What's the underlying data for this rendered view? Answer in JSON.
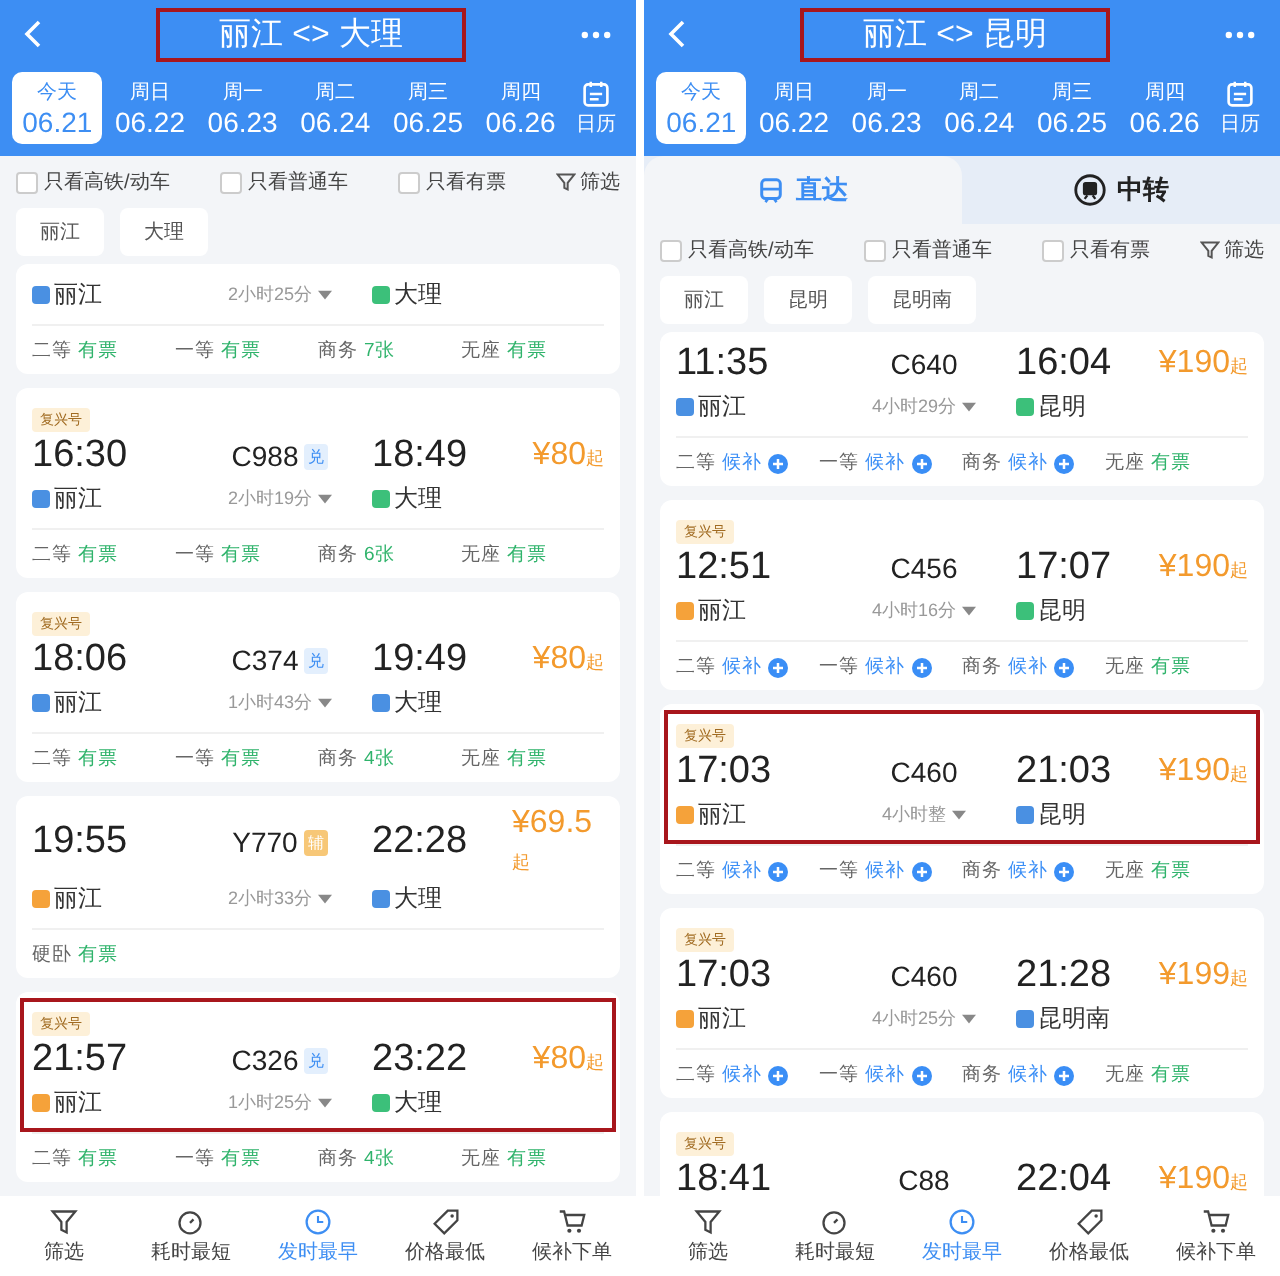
{
  "panels": [
    {
      "title": "丽江 <> 大理",
      "title_highlighted": true,
      "dates": [
        {
          "weekday": "今天",
          "date": "06.21",
          "selected": true
        },
        {
          "weekday": "周日",
          "date": "06.22",
          "selected": false
        },
        {
          "weekday": "周一",
          "date": "06.23",
          "selected": false
        },
        {
          "weekday": "周二",
          "date": "06.24",
          "selected": false
        },
        {
          "weekday": "周三",
          "date": "06.25",
          "selected": false
        },
        {
          "weekday": "周四",
          "date": "06.26",
          "selected": false
        }
      ],
      "calendar": "日历",
      "filters": [
        {
          "label": "只看高铁/动车",
          "checked": false
        },
        {
          "label": "只看普通车",
          "checked": false
        },
        {
          "label": "只看有票",
          "checked": false
        }
      ],
      "filter_button": "筛选",
      "stations": [
        "丽江",
        "大理"
      ],
      "trains": [
        {
          "from": {
            "name": "丽江",
            "color": "#4a90e2"
          },
          "duration": "2小时25分",
          "to": {
            "name": "大理",
            "color": "#3cc07a"
          },
          "highlighted": false,
          "seats": [
            {
              "label": "二等",
              "status": "有票",
              "waitlist": false
            },
            {
              "label": "一等",
              "status": "有票",
              "waitlist": false
            },
            {
              "label": "商务",
              "status": "7张",
              "waitlist": false
            },
            {
              "label": "无座",
              "status": "有票",
              "waitlist": false
            }
          ]
        },
        {
          "tag": "复兴号",
          "dep": "16:30",
          "train_no": "C988",
          "badge": {
            "text": "兑",
            "kind": "blue"
          },
          "arr": "18:49",
          "price": "¥80",
          "price_suffix": "起",
          "from": {
            "name": "丽江",
            "color": "#4a90e2"
          },
          "duration": "2小时19分",
          "to": {
            "name": "大理",
            "color": "#3cc07a"
          },
          "highlighted": false,
          "seats": [
            {
              "label": "二等",
              "status": "有票",
              "waitlist": false
            },
            {
              "label": "一等",
              "status": "有票",
              "waitlist": false
            },
            {
              "label": "商务",
              "status": "6张",
              "waitlist": false
            },
            {
              "label": "无座",
              "status": "有票",
              "waitlist": false
            }
          ]
        },
        {
          "tag": "复兴号",
          "dep": "18:06",
          "train_no": "C374",
          "badge": {
            "text": "兑",
            "kind": "blue"
          },
          "arr": "19:49",
          "price": "¥80",
          "price_suffix": "起",
          "from": {
            "name": "丽江",
            "color": "#4a90e2"
          },
          "duration": "1小时43分",
          "to": {
            "name": "大理",
            "color": "#4a90e2"
          },
          "highlighted": false,
          "seats": [
            {
              "label": "二等",
              "status": "有票",
              "waitlist": false
            },
            {
              "label": "一等",
              "status": "有票",
              "waitlist": false
            },
            {
              "label": "商务",
              "status": "4张",
              "waitlist": false
            },
            {
              "label": "无座",
              "status": "有票",
              "waitlist": false
            }
          ]
        },
        {
          "dep": "19:55",
          "train_no": "Y770",
          "badge": {
            "text": "辅",
            "kind": "orange"
          },
          "arr": "22:28",
          "price": "¥69.5",
          "price_suffix": "起",
          "from": {
            "name": "丽江",
            "color": "#f5a23a"
          },
          "duration": "2小时33分",
          "to": {
            "name": "大理",
            "color": "#4a90e2"
          },
          "highlighted": false,
          "seats": [
            {
              "label": "硬卧",
              "status": "有票",
              "waitlist": false
            }
          ]
        },
        {
          "tag": "复兴号",
          "dep": "21:57",
          "train_no": "C326",
          "badge": {
            "text": "兑",
            "kind": "blue"
          },
          "arr": "23:22",
          "price": "¥80",
          "price_suffix": "起",
          "from": {
            "name": "丽江",
            "color": "#f5a23a"
          },
          "duration": "1小时25分",
          "to": {
            "name": "大理",
            "color": "#3cc07a"
          },
          "highlighted": true,
          "seats": [
            {
              "label": "二等",
              "status": "有票",
              "waitlist": false
            },
            {
              "label": "一等",
              "status": "有票",
              "waitlist": false
            },
            {
              "label": "商务",
              "status": "4张",
              "waitlist": false
            },
            {
              "label": "无座",
              "status": "有票",
              "waitlist": false
            }
          ]
        }
      ],
      "bottom_nav": [
        {
          "kind": "filter",
          "label": "筛选",
          "selected": false
        },
        {
          "kind": "timer",
          "label": "耗时最短",
          "selected": false
        },
        {
          "kind": "early",
          "label": "发时最早",
          "selected": true
        },
        {
          "kind": "price",
          "label": "价格最低",
          "selected": false
        },
        {
          "kind": "cart",
          "label": "候补下单",
          "selected": false
        }
      ]
    },
    {
      "title": "丽江 <> 昆明",
      "title_highlighted": true,
      "dates": [
        {
          "weekday": "今天",
          "date": "06.21",
          "selected": true
        },
        {
          "weekday": "周日",
          "date": "06.22",
          "selected": false
        },
        {
          "weekday": "周一",
          "date": "06.23",
          "selected": false
        },
        {
          "weekday": "周二",
          "date": "06.24",
          "selected": false
        },
        {
          "weekday": "周三",
          "date": "06.25",
          "selected": false
        },
        {
          "weekday": "周四",
          "date": "06.26",
          "selected": false
        }
      ],
      "calendar": "日历",
      "tabs": [
        {
          "kind": "direct",
          "label": "直达",
          "selected": true
        },
        {
          "kind": "transfer",
          "label": "中转",
          "selected": false
        }
      ],
      "filters": [
        {
          "label": "只看高铁/动车",
          "checked": false
        },
        {
          "label": "只看普通车",
          "checked": false
        },
        {
          "label": "只看有票",
          "checked": false
        }
      ],
      "filter_button": "筛选",
      "stations": [
        "丽江",
        "昆明",
        "昆明南"
      ],
      "trains": [
        {
          "dep": "11:35",
          "train_no": "C640",
          "arr": "16:04",
          "price": "¥190",
          "price_suffix": "起",
          "from": {
            "name": "丽江",
            "color": "#4a90e2"
          },
          "duration": "4小时29分",
          "to": {
            "name": "昆明",
            "color": "#3cc07a"
          },
          "highlighted": false,
          "seats": [
            {
              "label": "二等",
              "status": "候补",
              "waitlist": true
            },
            {
              "label": "一等",
              "status": "候补",
              "waitlist": true
            },
            {
              "label": "商务",
              "status": "候补",
              "waitlist": true
            },
            {
              "label": "无座",
              "status": "有票",
              "waitlist": false
            }
          ]
        },
        {
          "tag": "复兴号",
          "dep": "12:51",
          "train_no": "C456",
          "arr": "17:07",
          "price": "¥190",
          "price_suffix": "起",
          "from": {
            "name": "丽江",
            "color": "#f5a23a"
          },
          "duration": "4小时16分",
          "to": {
            "name": "昆明",
            "color": "#3cc07a"
          },
          "highlighted": false,
          "seats": [
            {
              "label": "二等",
              "status": "候补",
              "waitlist": true
            },
            {
              "label": "一等",
              "status": "候补",
              "waitlist": true
            },
            {
              "label": "商务",
              "status": "候补",
              "waitlist": true
            },
            {
              "label": "无座",
              "status": "有票",
              "waitlist": false
            }
          ]
        },
        {
          "tag": "复兴号",
          "dep": "17:03",
          "train_no": "C460",
          "arr": "21:03",
          "price": "¥190",
          "price_suffix": "起",
          "from": {
            "name": "丽江",
            "color": "#f5a23a"
          },
          "duration": "4小时整",
          "to": {
            "name": "昆明",
            "color": "#4a90e2"
          },
          "highlighted": true,
          "seats": [
            {
              "label": "二等",
              "status": "候补",
              "waitlist": true
            },
            {
              "label": "一等",
              "status": "候补",
              "waitlist": true
            },
            {
              "label": "商务",
              "status": "候补",
              "waitlist": true
            },
            {
              "label": "无座",
              "status": "有票",
              "waitlist": false
            }
          ]
        },
        {
          "tag": "复兴号",
          "dep": "17:03",
          "train_no": "C460",
          "arr": "21:28",
          "price": "¥199",
          "price_suffix": "起",
          "from": {
            "name": "丽江",
            "color": "#f5a23a"
          },
          "duration": "4小时25分",
          "to": {
            "name": "昆明南",
            "color": "#4a90e2"
          },
          "highlighted": false,
          "seats": [
            {
              "label": "二等",
              "status": "候补",
              "waitlist": true
            },
            {
              "label": "一等",
              "status": "候补",
              "waitlist": true
            },
            {
              "label": "商务",
              "status": "候补",
              "waitlist": true
            },
            {
              "label": "无座",
              "status": "有票",
              "waitlist": false
            }
          ]
        },
        {
          "tag": "复兴号",
          "dep": "18:41",
          "train_no": "C88",
          "arr": "22:04",
          "price": "¥190",
          "price_suffix": "起",
          "highlighted": false
        }
      ],
      "bottom_nav": [
        {
          "kind": "filter",
          "label": "筛选",
          "selected": false
        },
        {
          "kind": "timer",
          "label": "耗时最短",
          "selected": false
        },
        {
          "kind": "early",
          "label": "发时最早",
          "selected": true
        },
        {
          "kind": "price",
          "label": "价格最低",
          "selected": false
        },
        {
          "kind": "cart",
          "label": "候补下单",
          "selected": false
        }
      ]
    }
  ]
}
